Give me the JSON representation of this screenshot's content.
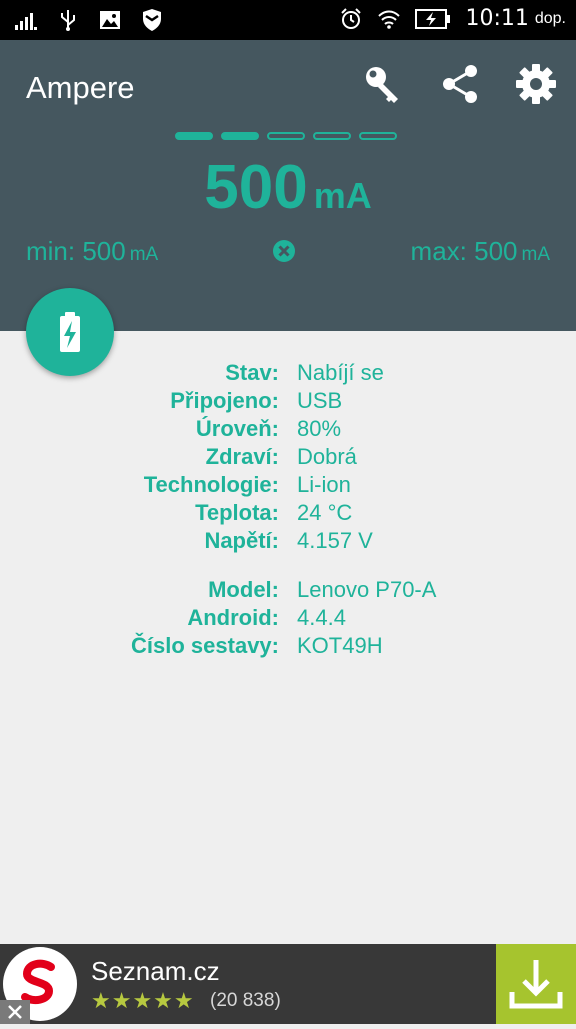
{
  "status_bar": {
    "time": "10:11",
    "ampm": "dop.",
    "icons": [
      "signal-icon",
      "usb-icon",
      "image-icon",
      "shield-icon",
      "alarm-icon",
      "wifi-icon",
      "battery-charging-icon"
    ]
  },
  "app_bar": {
    "title": "Ampere",
    "actions": [
      "key-icon",
      "share-icon",
      "settings-icon"
    ]
  },
  "meter": {
    "dashes_total": 5,
    "dashes_filled": 2,
    "current_value": "500",
    "current_unit": "mA",
    "min_label": "min: 500",
    "min_unit": "mA",
    "max_label": "max: 500",
    "max_unit": "mA"
  },
  "info": {
    "battery": [
      {
        "label": "Stav:",
        "value": "Nabíjí se"
      },
      {
        "label": "Připojeno:",
        "value": "USB"
      },
      {
        "label": "Úroveň:",
        "value": "80%"
      },
      {
        "label": "Zdraví:",
        "value": "Dobrá"
      },
      {
        "label": "Technologie:",
        "value": "Li-ion"
      },
      {
        "label": "Teplota:",
        "value": "24 °C"
      },
      {
        "label": "Napětí:",
        "value": "4.157 V"
      }
    ],
    "device": [
      {
        "label": "Model:",
        "value": "Lenovo P70-A"
      },
      {
        "label": "Android:",
        "value": "4.4.4"
      },
      {
        "label": "Číslo sestavy:",
        "value": "KOT49H"
      }
    ]
  },
  "ad": {
    "title": "Seznam.cz",
    "rating_stars": 4.5,
    "stars_text": "★★★★★",
    "reviews": "(20 838)",
    "accent": "#a6c42e",
    "logo_color": "#e2001a"
  },
  "colors": {
    "accent": "#1fb39a",
    "header_bg": "#45575f",
    "body_bg": "#efefef"
  }
}
